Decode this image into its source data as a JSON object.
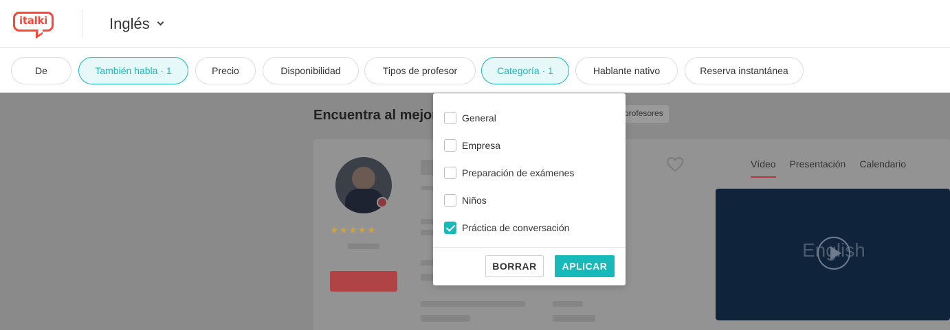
{
  "header": {
    "logo_text": "italki",
    "language": "Inglés"
  },
  "filters": [
    {
      "label": "De",
      "active": false
    },
    {
      "label": "También habla · 1",
      "active": true
    },
    {
      "label": "Precio",
      "active": false
    },
    {
      "label": "Disponibilidad",
      "active": false
    },
    {
      "label": "Tipos de profesor",
      "active": false
    },
    {
      "label": "Categoría · 1",
      "active": true
    },
    {
      "label": "Hablante nativo",
      "active": false
    },
    {
      "label": "Reserva instantánea",
      "active": false
    }
  ],
  "main": {
    "heading": "Encuentra al mejor",
    "count_chip": "profesores",
    "media_tabs": [
      "Vídeo",
      "Presentación",
      "Calendario"
    ],
    "active_media_tab": "Vídeo",
    "video_word": "English"
  },
  "category_dropdown": {
    "options": [
      {
        "label": "General",
        "checked": false
      },
      {
        "label": "Empresa",
        "checked": false
      },
      {
        "label": "Preparación de exámenes",
        "checked": false
      },
      {
        "label": "Niños",
        "checked": false
      },
      {
        "label": "Práctica de conversación",
        "checked": true
      }
    ],
    "clear_label": "BORRAR",
    "apply_label": "APLICAR"
  },
  "colors": {
    "brand": "#ff4438",
    "accent": "#17b9b9",
    "overlay": "#8a8a8a"
  }
}
